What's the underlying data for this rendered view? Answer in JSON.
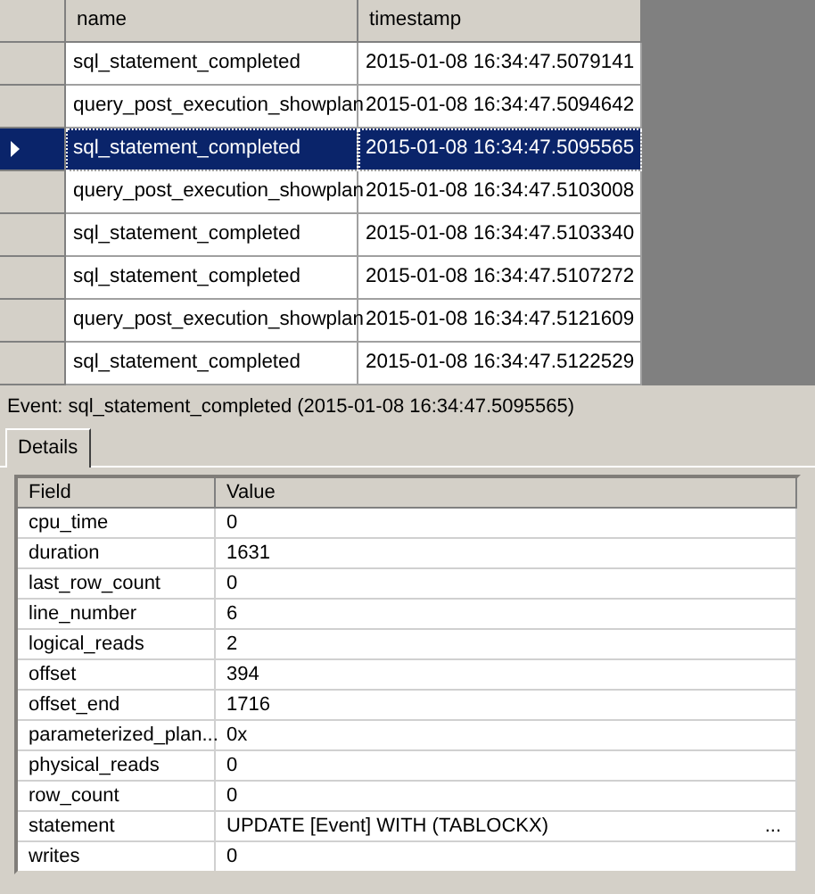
{
  "events_grid": {
    "columns": [
      "name",
      "timestamp"
    ],
    "rows": [
      {
        "name": "sql_statement_completed",
        "timestamp": "2015-01-08 16:34:47.5079141",
        "selected": false
      },
      {
        "name": "query_post_execution_showplan",
        "timestamp": "2015-01-08 16:34:47.5094642",
        "selected": false
      },
      {
        "name": "sql_statement_completed",
        "timestamp": "2015-01-08 16:34:47.5095565",
        "selected": true
      },
      {
        "name": "query_post_execution_showplan",
        "timestamp": "2015-01-08 16:34:47.5103008",
        "selected": false
      },
      {
        "name": "sql_statement_completed",
        "timestamp": "2015-01-08 16:34:47.5103340",
        "selected": false
      },
      {
        "name": "sql_statement_completed",
        "timestamp": "2015-01-08 16:34:47.5107272",
        "selected": false
      },
      {
        "name": "query_post_execution_showplan",
        "timestamp": "2015-01-08 16:34:47.5121609",
        "selected": false
      },
      {
        "name": "sql_statement_completed",
        "timestamp": "2015-01-08 16:34:47.5122529",
        "selected": false
      }
    ]
  },
  "event_label": "Event: sql_statement_completed (2015-01-08 16:34:47.5095565)",
  "tabs": [
    {
      "label": "Details",
      "selected": true
    }
  ],
  "details_grid": {
    "columns": [
      "Field",
      "Value"
    ],
    "rows": [
      {
        "field": "cpu_time",
        "value": "0"
      },
      {
        "field": "duration",
        "value": "1631"
      },
      {
        "field": "last_row_count",
        "value": "0"
      },
      {
        "field": "line_number",
        "value": "6"
      },
      {
        "field": "logical_reads",
        "value": "2"
      },
      {
        "field": "offset",
        "value": "394"
      },
      {
        "field": "offset_end",
        "value": "1716"
      },
      {
        "field": "parameterized_plan...",
        "value": "0x"
      },
      {
        "field": "physical_reads",
        "value": "0"
      },
      {
        "field": "row_count",
        "value": "0"
      },
      {
        "field": "statement",
        "value": "UPDATE [Event] WITH (TABLOCKX)",
        "more": "..."
      },
      {
        "field": "writes",
        "value": "0"
      }
    ]
  }
}
